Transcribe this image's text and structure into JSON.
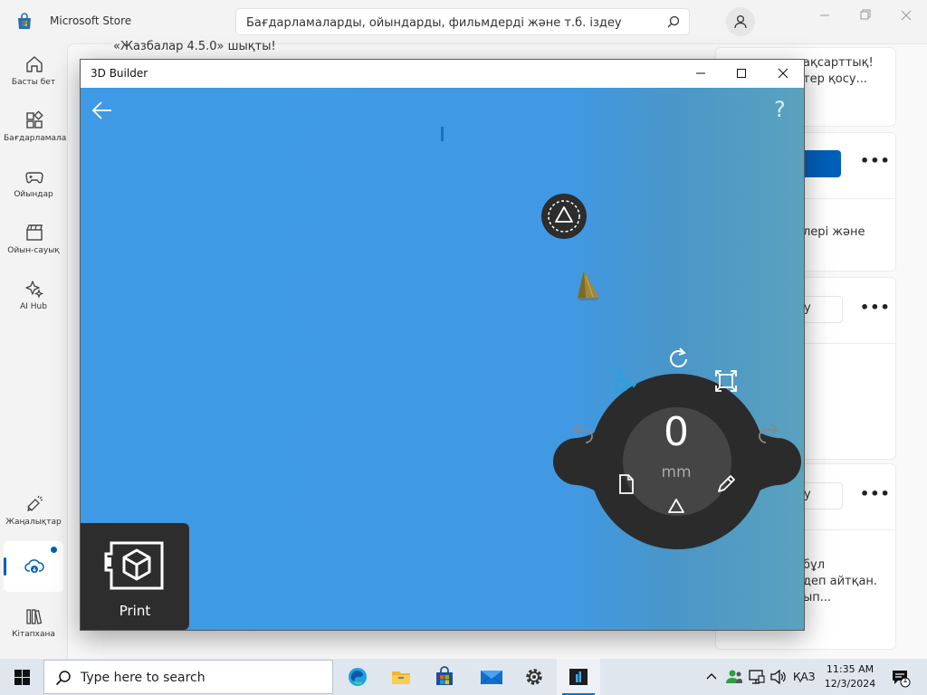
{
  "store": {
    "title": "Microsoft Store",
    "search_placeholder": "Бағдарламаларды, ойындарды, фильмдерді және т.б. іздеу",
    "nav": [
      {
        "label": "Басты бет",
        "icon": "home-icon"
      },
      {
        "label": "Бағдарламалар",
        "icon": "apps-icon"
      },
      {
        "label": "Ойындар",
        "icon": "gamepad-icon"
      },
      {
        "label": "Ойын-сауық",
        "icon": "clapperboard-icon"
      },
      {
        "label": "AI Hub",
        "icon": "sparkle-icon"
      },
      {
        "label": "Жаңалықтар",
        "icon": "megaphone-icon"
      },
      {
        "label": "",
        "icon": "cloud-download-icon",
        "active": true,
        "badge": true
      },
      {
        "label": "Кітапхана",
        "icon": "library-icon"
      }
    ],
    "background_text": {
      "top_left": "«Жазбалар 4.5.0» шықты!",
      "card1_line1": "ақсарттық!",
      "card1_line2": "тер қосу...",
      "card2_line1": "лері және",
      "card3_btn": "у",
      "card4_btn": "у",
      "card5_line1": "бұл",
      "card5_line2": "деп айтқан.",
      "card5_line3": "ып..."
    },
    "accent_color": "#005fb8"
  },
  "builder": {
    "title": "3D Builder",
    "help": "?",
    "wheel_value": "0",
    "wheel_unit": "mm",
    "print_label": "Print",
    "canvas_color": "#3f9ae5"
  },
  "taskbar": {
    "search_placeholder": "Type here to search",
    "apps": [
      "edge-icon",
      "file-explorer-icon",
      "store-icon",
      "mail-icon",
      "settings-icon",
      "3d-builder-icon"
    ],
    "language": "ҚАЗ",
    "time": "11:35 AM",
    "date": "12/3/2024",
    "notification_count": "1"
  }
}
